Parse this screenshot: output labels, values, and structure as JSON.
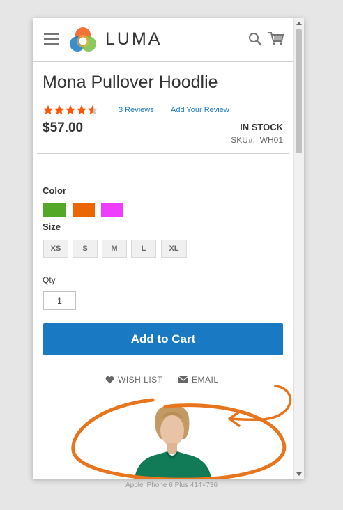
{
  "header": {
    "logo_text": "LUMA",
    "menu_icon": "hamburger-menu-icon",
    "search_icon": "search-icon",
    "cart_icon": "cart-icon"
  },
  "product": {
    "title": "Mona Pullover Hoodlie",
    "rating_stars": 4.5,
    "rating_max": 5,
    "reviews_link": "3 Reviews",
    "add_review_link": "Add Your Review",
    "price": "$57.00",
    "stock": "IN STOCK",
    "sku_label": "SKU#:",
    "sku_value": "WH01"
  },
  "options": {
    "color_label": "Color",
    "colors": [
      {
        "name": "Green",
        "hex": "#53a828"
      },
      {
        "name": "Orange",
        "hex": "#eb6703"
      },
      {
        "name": "Purple",
        "hex": "#ef3dff"
      }
    ],
    "size_label": "Size",
    "sizes": [
      "XS",
      "S",
      "M",
      "L",
      "XL"
    ],
    "qty_label": "Qty",
    "qty_value": "1"
  },
  "actions": {
    "add_to_cart": "Add to Cart",
    "wish_list": "WISH LIST",
    "email": "EMAIL"
  },
  "colors": {
    "primary": "#1979c3",
    "star": "#ff5501",
    "annotation": "#e8741c"
  },
  "device_caption": "Apple iPhone 6 Plus   414×736"
}
